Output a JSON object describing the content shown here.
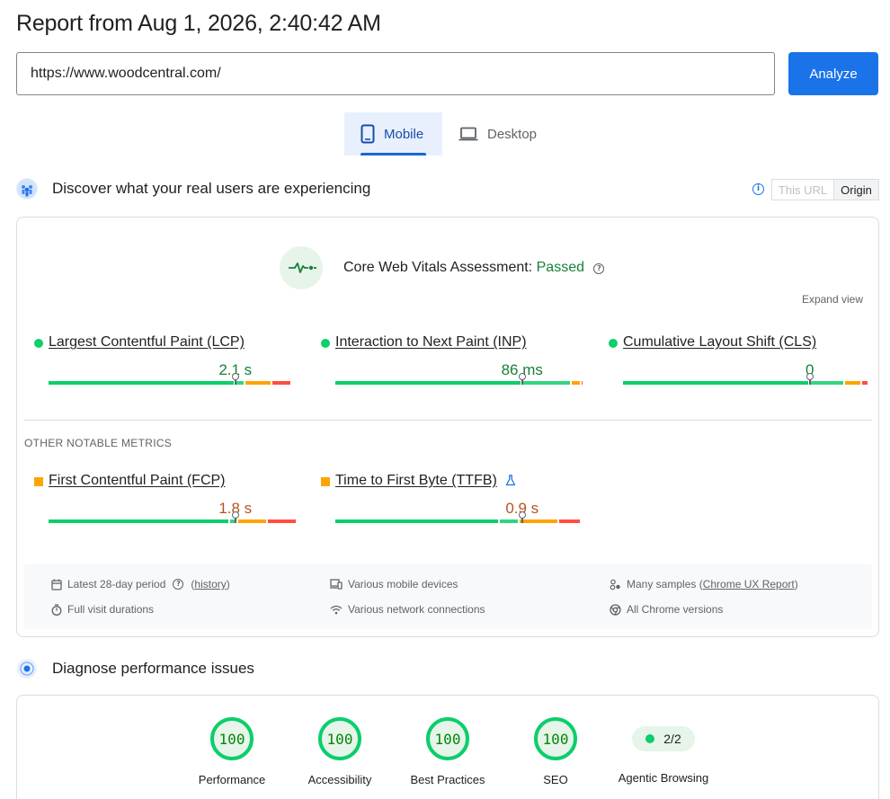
{
  "header": {
    "title": "Report from Aug 1, 2026, 2:40:42 AM"
  },
  "search": {
    "url": "https://www.woodcentral.com/",
    "analyze_label": "Analyze"
  },
  "tabs": [
    {
      "label": "Mobile",
      "active": true,
      "icon": "phone-icon"
    },
    {
      "label": "Desktop",
      "active": false,
      "icon": "laptop-icon"
    }
  ],
  "field_data": {
    "heading": "Discover what your real users are experiencing",
    "toggle": {
      "this_url": "This URL",
      "origin": "Origin",
      "selected": "Origin"
    },
    "assessment": {
      "label": "Core Web Vitals Assessment:",
      "status": "Passed"
    },
    "expand_label": "Expand view",
    "core_metrics": [
      {
        "name": "Largest Contentful Paint (LCP)",
        "value": "2.1 s",
        "rating": "good",
        "marker": 0.75,
        "split": [
          0.75,
          0.04,
          0.11,
          0.08
        ]
      },
      {
        "name": "Interaction to Next Paint (INP)",
        "value": "86 ms",
        "rating": "good",
        "marker": 0.75,
        "split": [
          0.75,
          0.2,
          0.04,
          0.01
        ]
      },
      {
        "name": "Cumulative Layout Shift (CLS)",
        "value": "0",
        "rating": "good",
        "marker": 0.75,
        "split": [
          0.75,
          0.14,
          0.07,
          0.03
        ]
      }
    ],
    "other_label": "OTHER NOTABLE METRICS",
    "other_metrics": [
      {
        "name": "First Contentful Paint (FCP)",
        "value": "1.8 s",
        "rating": "average",
        "marker": 0.75,
        "split": [
          0.73,
          0.03,
          0.12,
          0.12
        ]
      },
      {
        "name": "Time to First Byte (TTFB)",
        "value": "0.9 s",
        "rating": "average",
        "marker": 0.75,
        "split": [
          0.66,
          0.08,
          0.16,
          0.09
        ],
        "experimental": true
      }
    ],
    "footer": {
      "period": "Latest 28-day period",
      "history": "history",
      "devices": "Various mobile devices",
      "samples_prefix": "Many samples (",
      "samples_link": "Chrome UX Report",
      "samples_suffix": ")",
      "visits": "Full visit durations",
      "network": "Various network connections",
      "versions": "All Chrome versions"
    }
  },
  "diagnose": {
    "heading": "Diagnose performance issues",
    "scores": [
      {
        "label": "Performance",
        "value": "100"
      },
      {
        "label": "Accessibility",
        "value": "100"
      },
      {
        "label": "Best Practices",
        "value": "100"
      },
      {
        "label": "SEO",
        "value": "100"
      }
    ],
    "agentic": {
      "label": "Agentic Browsing",
      "value": "2/2"
    }
  },
  "colors": {
    "accent": "#1a73e8",
    "good": "#0cce6b",
    "average": "#ffa400",
    "poor": "#ff4e42"
  }
}
